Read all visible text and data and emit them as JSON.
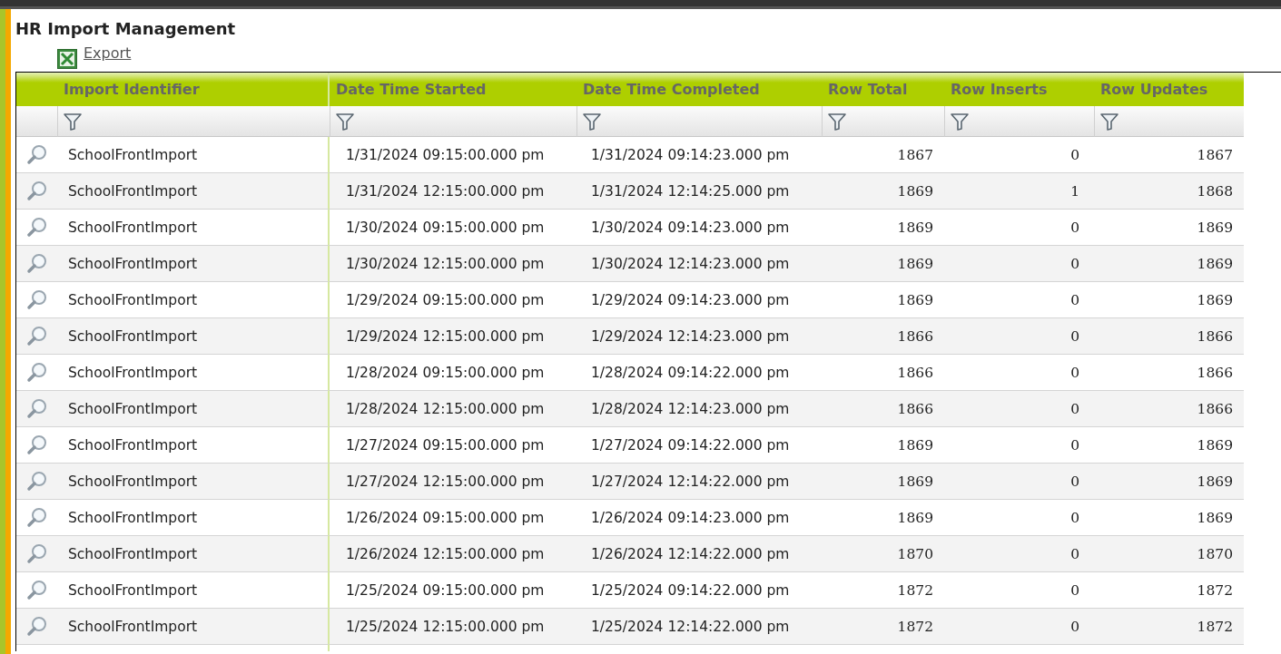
{
  "page": {
    "title": "HR Import Management"
  },
  "export": {
    "label": "Export"
  },
  "table": {
    "columns": [
      "Import Identifier",
      "Date Time Started",
      "Date Time Completed",
      "Row Total",
      "Row Inserts",
      "Row Updates"
    ],
    "rows": [
      {
        "identifier": "SchoolFrontImport",
        "started": "1/31/2024 09:15:00.000 pm",
        "completed": "1/31/2024 09:14:23.000 pm",
        "total": "1867",
        "inserts": "0",
        "updates": "1867"
      },
      {
        "identifier": "SchoolFrontImport",
        "started": "1/31/2024 12:15:00.000 pm",
        "completed": "1/31/2024 12:14:25.000 pm",
        "total": "1869",
        "inserts": "1",
        "updates": "1868"
      },
      {
        "identifier": "SchoolFrontImport",
        "started": "1/30/2024 09:15:00.000 pm",
        "completed": "1/30/2024 09:14:23.000 pm",
        "total": "1869",
        "inserts": "0",
        "updates": "1869"
      },
      {
        "identifier": "SchoolFrontImport",
        "started": "1/30/2024 12:15:00.000 pm",
        "completed": "1/30/2024 12:14:23.000 pm",
        "total": "1869",
        "inserts": "0",
        "updates": "1869"
      },
      {
        "identifier": "SchoolFrontImport",
        "started": "1/29/2024 09:15:00.000 pm",
        "completed": "1/29/2024 09:14:23.000 pm",
        "total": "1869",
        "inserts": "0",
        "updates": "1869"
      },
      {
        "identifier": "SchoolFrontImport",
        "started": "1/29/2024 12:15:00.000 pm",
        "completed": "1/29/2024 12:14:23.000 pm",
        "total": "1866",
        "inserts": "0",
        "updates": "1866"
      },
      {
        "identifier": "SchoolFrontImport",
        "started": "1/28/2024 09:15:00.000 pm",
        "completed": "1/28/2024 09:14:22.000 pm",
        "total": "1866",
        "inserts": "0",
        "updates": "1866"
      },
      {
        "identifier": "SchoolFrontImport",
        "started": "1/28/2024 12:15:00.000 pm",
        "completed": "1/28/2024 12:14:23.000 pm",
        "total": "1866",
        "inserts": "0",
        "updates": "1866"
      },
      {
        "identifier": "SchoolFrontImport",
        "started": "1/27/2024 09:15:00.000 pm",
        "completed": "1/27/2024 09:14:22.000 pm",
        "total": "1869",
        "inserts": "0",
        "updates": "1869"
      },
      {
        "identifier": "SchoolFrontImport",
        "started": "1/27/2024 12:15:00.000 pm",
        "completed": "1/27/2024 12:14:22.000 pm",
        "total": "1869",
        "inserts": "0",
        "updates": "1869"
      },
      {
        "identifier": "SchoolFrontImport",
        "started": "1/26/2024 09:15:00.000 pm",
        "completed": "1/26/2024 09:14:23.000 pm",
        "total": "1869",
        "inserts": "0",
        "updates": "1869"
      },
      {
        "identifier": "SchoolFrontImport",
        "started": "1/26/2024 12:15:00.000 pm",
        "completed": "1/26/2024 12:14:22.000 pm",
        "total": "1870",
        "inserts": "0",
        "updates": "1870"
      },
      {
        "identifier": "SchoolFrontImport",
        "started": "1/25/2024 09:15:00.000 pm",
        "completed": "1/25/2024 09:14:22.000 pm",
        "total": "1872",
        "inserts": "0",
        "updates": "1872"
      },
      {
        "identifier": "SchoolFrontImport",
        "started": "1/25/2024 12:15:00.000 pm",
        "completed": "1/25/2024 12:14:22.000 pm",
        "total": "1872",
        "inserts": "0",
        "updates": "1872"
      }
    ]
  }
}
